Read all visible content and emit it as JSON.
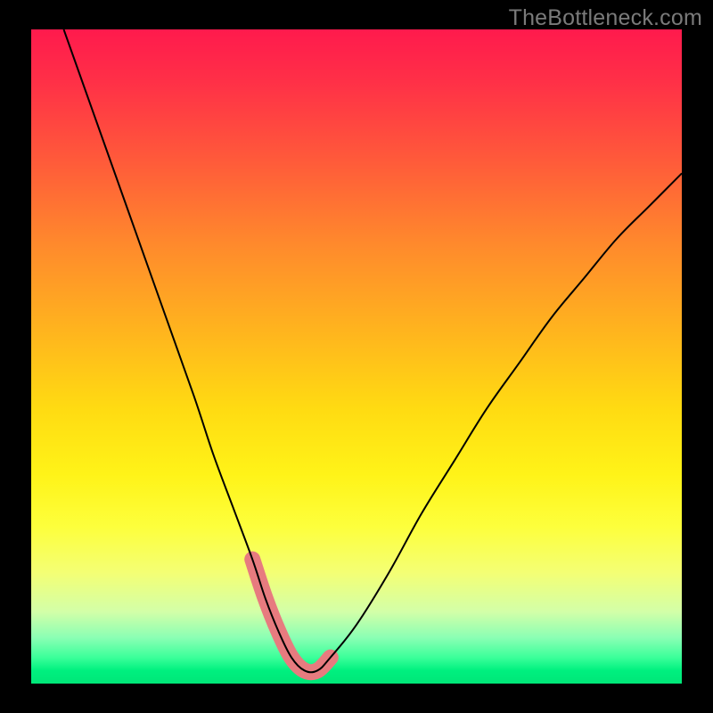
{
  "watermark": "TheBottleneck.com",
  "colors": {
    "accent_pink": "#e77b7f",
    "curve_stroke": "#000000"
  },
  "chart_data": {
    "type": "line",
    "title": "",
    "xlabel": "",
    "ylabel": "",
    "xlim": [
      0,
      100
    ],
    "ylim": [
      0,
      100
    ],
    "series": [
      {
        "name": "bottleneck-curve",
        "x": [
          5,
          10,
          15,
          20,
          25,
          28,
          31,
          34,
          36,
          38,
          40,
          42,
          44,
          46,
          50,
          55,
          60,
          65,
          70,
          75,
          80,
          85,
          90,
          95,
          100
        ],
        "y": [
          100,
          86,
          72,
          58,
          44,
          35,
          27,
          19,
          13,
          8,
          4,
          2,
          2,
          4,
          9,
          17,
          26,
          34,
          42,
          49,
          56,
          62,
          68,
          73,
          78
        ]
      },
      {
        "name": "highlight-band",
        "x": [
          34,
          36,
          38,
          40,
          42,
          44,
          46
        ],
        "y": [
          19,
          13,
          8,
          4,
          2,
          2,
          4
        ]
      }
    ],
    "annotations": []
  }
}
